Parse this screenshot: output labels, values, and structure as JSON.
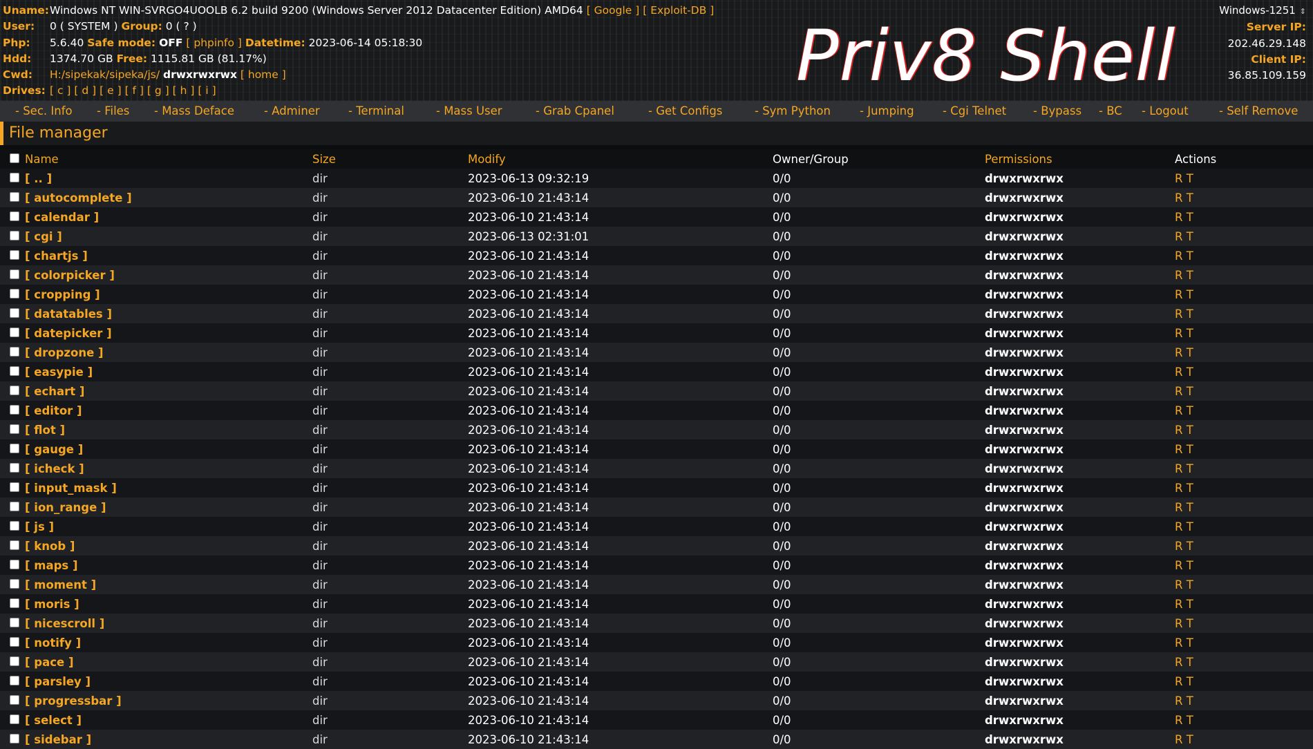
{
  "header": {
    "uname_label": "Uname:",
    "uname_value": "Windows NT WIN-SVRGO4UOOLB 6.2 build 9200 (Windows Server 2012 Datacenter Edition) AMD64",
    "google_link": "[ Google ]",
    "exploitdb_link": "[ Exploit-DB ]",
    "user_label": "User:",
    "user_value": "0 ( SYSTEM )",
    "group_label": "Group:",
    "group_value": "0 ( ? )",
    "php_label": "Php:",
    "php_value": "5.6.40",
    "safe_mode_label": "Safe mode:",
    "safe_mode_value": "OFF",
    "phpinfo_link": "[ phpinfo ]",
    "datetime_label": "Datetime:",
    "datetime_value": "2023-06-14 05:18:30",
    "hdd_label": "Hdd:",
    "hdd_value": "1374.70 GB",
    "free_label": "Free:",
    "free_value": "1115.81 GB (81.17%)",
    "cwd_label": "Cwd:",
    "cwd_path": "H:/sipekak/sipeka/js/",
    "cwd_perms": "drwxrwxrwx",
    "home_link": "[ home ]",
    "drives_label": "Drives:",
    "drives": [
      "[ c ]",
      "[ d ]",
      "[ e ]",
      "[ f ]",
      "[ g ]",
      "[ h ]",
      "[ i ]"
    ],
    "logo_text": "Priv8 Shell",
    "charset_select": "Windows-1251",
    "server_ip_label": "Server IP:",
    "server_ip": "202.46.29.148",
    "client_ip_label": "Client IP:",
    "client_ip": "36.85.109.159"
  },
  "menu": [
    "- Sec. Info",
    "- Files",
    "- Mass Deface",
    "- Adminer",
    "- Terminal",
    "- Mass User",
    "- Grab Cpanel",
    "- Get Configs",
    "- Sym Python",
    "- Jumping",
    "- Cgi Telnet",
    "- Bypass",
    "- BC",
    "- Logout",
    "- Self Remove"
  ],
  "file_manager": {
    "title": "File manager",
    "columns": [
      "Name",
      "Size",
      "Modify",
      "Owner/Group",
      "Permissions",
      "Actions"
    ],
    "rows": [
      {
        "name": "[ .. ]",
        "size": "dir",
        "modify": "2023-06-13 09:32:19",
        "owner": "0/0",
        "perms": "drwxrwxrwx",
        "actions": "R T"
      },
      {
        "name": "[ autocomplete ]",
        "size": "dir",
        "modify": "2023-06-10 21:43:14",
        "owner": "0/0",
        "perms": "drwxrwxrwx",
        "actions": "R T"
      },
      {
        "name": "[ calendar ]",
        "size": "dir",
        "modify": "2023-06-10 21:43:14",
        "owner": "0/0",
        "perms": "drwxrwxrwx",
        "actions": "R T"
      },
      {
        "name": "[ cgi ]",
        "size": "dir",
        "modify": "2023-06-13 02:31:01",
        "owner": "0/0",
        "perms": "drwxrwxrwx",
        "actions": "R T"
      },
      {
        "name": "[ chartjs ]",
        "size": "dir",
        "modify": "2023-06-10 21:43:14",
        "owner": "0/0",
        "perms": "drwxrwxrwx",
        "actions": "R T"
      },
      {
        "name": "[ colorpicker ]",
        "size": "dir",
        "modify": "2023-06-10 21:43:14",
        "owner": "0/0",
        "perms": "drwxrwxrwx",
        "actions": "R T"
      },
      {
        "name": "[ cropping ]",
        "size": "dir",
        "modify": "2023-06-10 21:43:14",
        "owner": "0/0",
        "perms": "drwxrwxrwx",
        "actions": "R T"
      },
      {
        "name": "[ datatables ]",
        "size": "dir",
        "modify": "2023-06-10 21:43:14",
        "owner": "0/0",
        "perms": "drwxrwxrwx",
        "actions": "R T"
      },
      {
        "name": "[ datepicker ]",
        "size": "dir",
        "modify": "2023-06-10 21:43:14",
        "owner": "0/0",
        "perms": "drwxrwxrwx",
        "actions": "R T"
      },
      {
        "name": "[ dropzone ]",
        "size": "dir",
        "modify": "2023-06-10 21:43:14",
        "owner": "0/0",
        "perms": "drwxrwxrwx",
        "actions": "R T"
      },
      {
        "name": "[ easypie ]",
        "size": "dir",
        "modify": "2023-06-10 21:43:14",
        "owner": "0/0",
        "perms": "drwxrwxrwx",
        "actions": "R T"
      },
      {
        "name": "[ echart ]",
        "size": "dir",
        "modify": "2023-06-10 21:43:14",
        "owner": "0/0",
        "perms": "drwxrwxrwx",
        "actions": "R T"
      },
      {
        "name": "[ editor ]",
        "size": "dir",
        "modify": "2023-06-10 21:43:14",
        "owner": "0/0",
        "perms": "drwxrwxrwx",
        "actions": "R T"
      },
      {
        "name": "[ flot ]",
        "size": "dir",
        "modify": "2023-06-10 21:43:14",
        "owner": "0/0",
        "perms": "drwxrwxrwx",
        "actions": "R T"
      },
      {
        "name": "[ gauge ]",
        "size": "dir",
        "modify": "2023-06-10 21:43:14",
        "owner": "0/0",
        "perms": "drwxrwxrwx",
        "actions": "R T"
      },
      {
        "name": "[ icheck ]",
        "size": "dir",
        "modify": "2023-06-10 21:43:14",
        "owner": "0/0",
        "perms": "drwxrwxrwx",
        "actions": "R T"
      },
      {
        "name": "[ input_mask ]",
        "size": "dir",
        "modify": "2023-06-10 21:43:14",
        "owner": "0/0",
        "perms": "drwxrwxrwx",
        "actions": "R T"
      },
      {
        "name": "[ ion_range ]",
        "size": "dir",
        "modify": "2023-06-10 21:43:14",
        "owner": "0/0",
        "perms": "drwxrwxrwx",
        "actions": "R T"
      },
      {
        "name": "[ js ]",
        "size": "dir",
        "modify": "2023-06-10 21:43:14",
        "owner": "0/0",
        "perms": "drwxrwxrwx",
        "actions": "R T"
      },
      {
        "name": "[ knob ]",
        "size": "dir",
        "modify": "2023-06-10 21:43:14",
        "owner": "0/0",
        "perms": "drwxrwxrwx",
        "actions": "R T"
      },
      {
        "name": "[ maps ]",
        "size": "dir",
        "modify": "2023-06-10 21:43:14",
        "owner": "0/0",
        "perms": "drwxrwxrwx",
        "actions": "R T"
      },
      {
        "name": "[ moment ]",
        "size": "dir",
        "modify": "2023-06-10 21:43:14",
        "owner": "0/0",
        "perms": "drwxrwxrwx",
        "actions": "R T"
      },
      {
        "name": "[ moris ]",
        "size": "dir",
        "modify": "2023-06-10 21:43:14",
        "owner": "0/0",
        "perms": "drwxrwxrwx",
        "actions": "R T"
      },
      {
        "name": "[ nicescroll ]",
        "size": "dir",
        "modify": "2023-06-10 21:43:14",
        "owner": "0/0",
        "perms": "drwxrwxrwx",
        "actions": "R T"
      },
      {
        "name": "[ notify ]",
        "size": "dir",
        "modify": "2023-06-10 21:43:14",
        "owner": "0/0",
        "perms": "drwxrwxrwx",
        "actions": "R T"
      },
      {
        "name": "[ pace ]",
        "size": "dir",
        "modify": "2023-06-10 21:43:14",
        "owner": "0/0",
        "perms": "drwxrwxrwx",
        "actions": "R T"
      },
      {
        "name": "[ parsley ]",
        "size": "dir",
        "modify": "2023-06-10 21:43:14",
        "owner": "0/0",
        "perms": "drwxrwxrwx",
        "actions": "R T"
      },
      {
        "name": "[ progressbar ]",
        "size": "dir",
        "modify": "2023-06-10 21:43:14",
        "owner": "0/0",
        "perms": "drwxrwxrwx",
        "actions": "R T"
      },
      {
        "name": "[ select ]",
        "size": "dir",
        "modify": "2023-06-10 21:43:14",
        "owner": "0/0",
        "perms": "drwxrwxrwx",
        "actions": "R T"
      },
      {
        "name": "[ sidebar ]",
        "size": "dir",
        "modify": "2023-06-10 21:43:14",
        "owner": "0/0",
        "perms": "drwxrwxrwx",
        "actions": "R T"
      }
    ]
  }
}
